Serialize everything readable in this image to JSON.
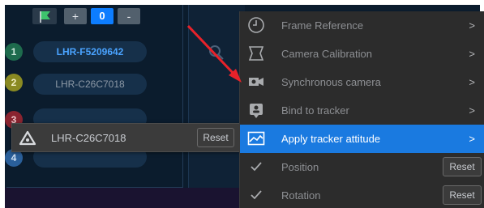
{
  "toolbar": {
    "plus_label": "+",
    "count_value": "0",
    "minus_label": "-"
  },
  "tracker_list": [
    {
      "number": "1",
      "name": "LHR-F5209642"
    },
    {
      "number": "2",
      "name": "LHR-C26C7018"
    },
    {
      "number": "3",
      "name": ""
    },
    {
      "number": "4",
      "name": ""
    }
  ],
  "selected_tracker": {
    "name": "LHR-C26C7018",
    "reset_label": "Reset"
  },
  "menu": {
    "items": [
      {
        "label": "Frame Reference",
        "icon": "clock-icon",
        "chevron": ">"
      },
      {
        "label": "Camera Calibration",
        "icon": "calibration-frame-icon",
        "chevron": ">"
      },
      {
        "label": "Synchronous camera",
        "icon": "video-camera-icon",
        "chevron": ">"
      },
      {
        "label": "Bind to tracker",
        "icon": "bind-tracker-icon",
        "chevron": ">"
      },
      {
        "label": "Apply tracker attitude",
        "icon": "tracker-attitude-icon",
        "chevron": ">"
      }
    ],
    "sub_items": [
      {
        "label": "Position",
        "icon": "check-icon",
        "reset_label": "Reset"
      },
      {
        "label": "Rotation",
        "icon": "check-icon",
        "reset_label": "Reset"
      }
    ]
  },
  "colors": {
    "accent": "#1a7ae0",
    "annotation_arrow": "#e8222a"
  }
}
